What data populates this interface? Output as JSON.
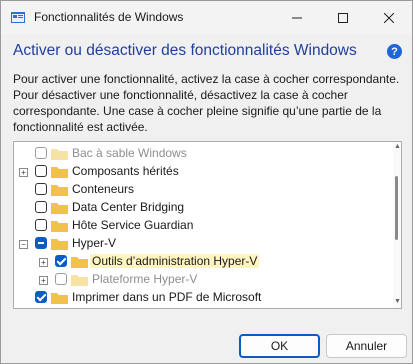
{
  "window": {
    "title": "Fonctionnalités de Windows"
  },
  "header": {
    "heading": "Activer ou désactiver des fonctionnalités Windows",
    "help_symbol": "?"
  },
  "description": {
    "line1": "Pour activer une fonctionnalité, activez la case à cocher correspondante.",
    "line2": "Pour désactiver une fonctionnalité, désactivez la case à cocher",
    "line3": "correspondante. Une case à cocher pleine signifie qu’une partie de la",
    "line4": "fonctionnalité est activée."
  },
  "tree": {
    "items": [
      {
        "label": "Bac à sable Windows",
        "state": "unchecked",
        "disabled": true,
        "expander": "",
        "level": 0
      },
      {
        "label": "Composants hérités",
        "state": "unchecked",
        "disabled": false,
        "expander": "+",
        "level": 0
      },
      {
        "label": "Conteneurs",
        "state": "unchecked",
        "disabled": false,
        "expander": "",
        "level": 0
      },
      {
        "label": "Data Center Bridging",
        "state": "unchecked",
        "disabled": false,
        "expander": "",
        "level": 0
      },
      {
        "label": "Hôte Service Guardian",
        "state": "unchecked",
        "disabled": false,
        "expander": "",
        "level": 0
      },
      {
        "label": "Hyper-V",
        "state": "partial",
        "disabled": false,
        "expander": "−",
        "level": 0
      },
      {
        "label": "Outils d’administration Hyper-V",
        "state": "checked",
        "disabled": false,
        "expander": "+",
        "level": 1,
        "selected": true
      },
      {
        "label": "Plateforme Hyper-V",
        "state": "unchecked",
        "disabled": true,
        "expander": "+",
        "level": 1
      },
      {
        "label": "Imprimer dans un PDF de Microsoft",
        "state": "checked",
        "disabled": false,
        "expander": "",
        "level": 0
      }
    ]
  },
  "buttons": {
    "ok": "OK",
    "cancel": "Annuler"
  },
  "icons": {
    "app": "windows-features-icon",
    "folder": "folder-icon"
  },
  "colors": {
    "accent": "#0a5cc5",
    "heading": "#1f3f9a",
    "selection": "#fdf4bf",
    "folder": "#f0c24a"
  }
}
